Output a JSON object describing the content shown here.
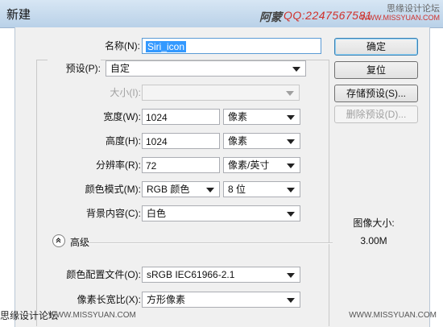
{
  "window": {
    "title": "新建",
    "watermark_author": "阿蒙",
    "watermark_qq": "QQ:2247567581",
    "watermark_site": "思缘设计论坛",
    "watermark_url": "WWW.MISSYUAN.COM"
  },
  "form": {
    "name_label": "名称(N):",
    "name_value": "Siri_icon",
    "preset_label": "预设(P):",
    "preset_value": "自定",
    "size_label": "大小(I):",
    "size_value": "",
    "width_label": "宽度(W):",
    "width_value": "1024",
    "width_unit": "像素",
    "height_label": "高度(H):",
    "height_value": "1024",
    "height_unit": "像素",
    "resolution_label": "分辨率(R):",
    "resolution_value": "72",
    "resolution_unit": "像素/英寸",
    "color_mode_label": "颜色模式(M):",
    "color_mode_value": "RGB 颜色",
    "bit_depth_value": "8 位",
    "background_label": "背景内容(C):",
    "background_value": "白色",
    "advanced_label": "高级",
    "color_profile_label": "颜色配置文件(O):",
    "color_profile_value": "sRGB IEC61966-2.1",
    "pixel_aspect_label": "像素长宽比(X):",
    "pixel_aspect_value": "方形像素"
  },
  "buttons": {
    "ok": "确定",
    "reset": "复位",
    "save_preset": "存储预设(S)...",
    "delete_preset": "删除预设(D)..."
  },
  "info": {
    "image_size_label": "图像大小:",
    "image_size_value": "3.00M"
  },
  "footer": {
    "site": "思缘设计论坛",
    "url_left": "WWW.MISSYUAN.COM",
    "url_right": "WWW.MISSYUAN.COM"
  }
}
